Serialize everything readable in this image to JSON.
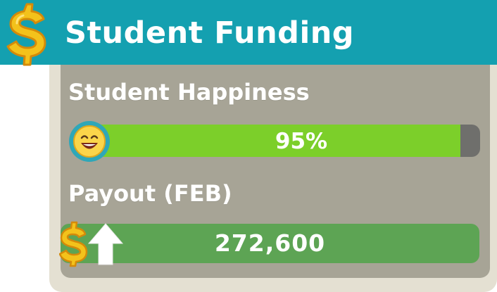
{
  "header": {
    "title": "Student Funding",
    "icon": "dollar-icon"
  },
  "happiness": {
    "label": "Student Happiness",
    "value_text": "95%",
    "level_fraction": 0.95,
    "icon": "happy-face-icon"
  },
  "payout": {
    "label": "Payout (FEB)",
    "value_text": "272,600",
    "icon": "dollar-up-arrow-icon"
  },
  "colors": {
    "header_bg": "#14a0b0",
    "panel_bg": "#a7a496",
    "happiness_fill": "#7ccf2a",
    "payout_bg": "#5da454",
    "gold": "#f3c21b"
  }
}
